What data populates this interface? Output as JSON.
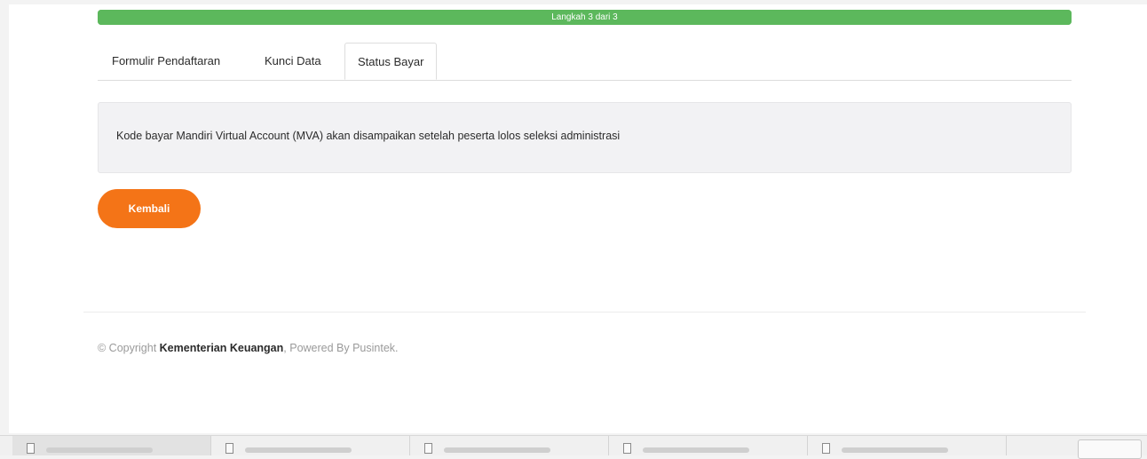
{
  "progress": {
    "label": "Langkah 3 dari 3",
    "value": 1.0,
    "color": "#5cb85c"
  },
  "tabs": [
    {
      "label": "Formulir Pendaftaran",
      "active": false
    },
    {
      "label": "Kunci Data",
      "active": false
    },
    {
      "label": "Status Bayar",
      "active": true
    }
  ],
  "info": {
    "message": "Kode bayar Mandiri Virtual Account (MVA) akan disampaikan setelah peserta lolos seleksi administrasi"
  },
  "actions": {
    "back_label": "Kembali",
    "back_color": "#f47417"
  },
  "footer": {
    "prefix": "© Copyright ",
    "org": "Kementerian Keuangan",
    "suffix": ", Powered By Pusintek."
  },
  "downloads": {
    "items": [
      {
        "icon": "file-icon"
      },
      {
        "icon": "file-icon"
      },
      {
        "icon": "file-icon"
      },
      {
        "icon": "file-icon"
      },
      {
        "icon": "file-icon"
      }
    ]
  }
}
